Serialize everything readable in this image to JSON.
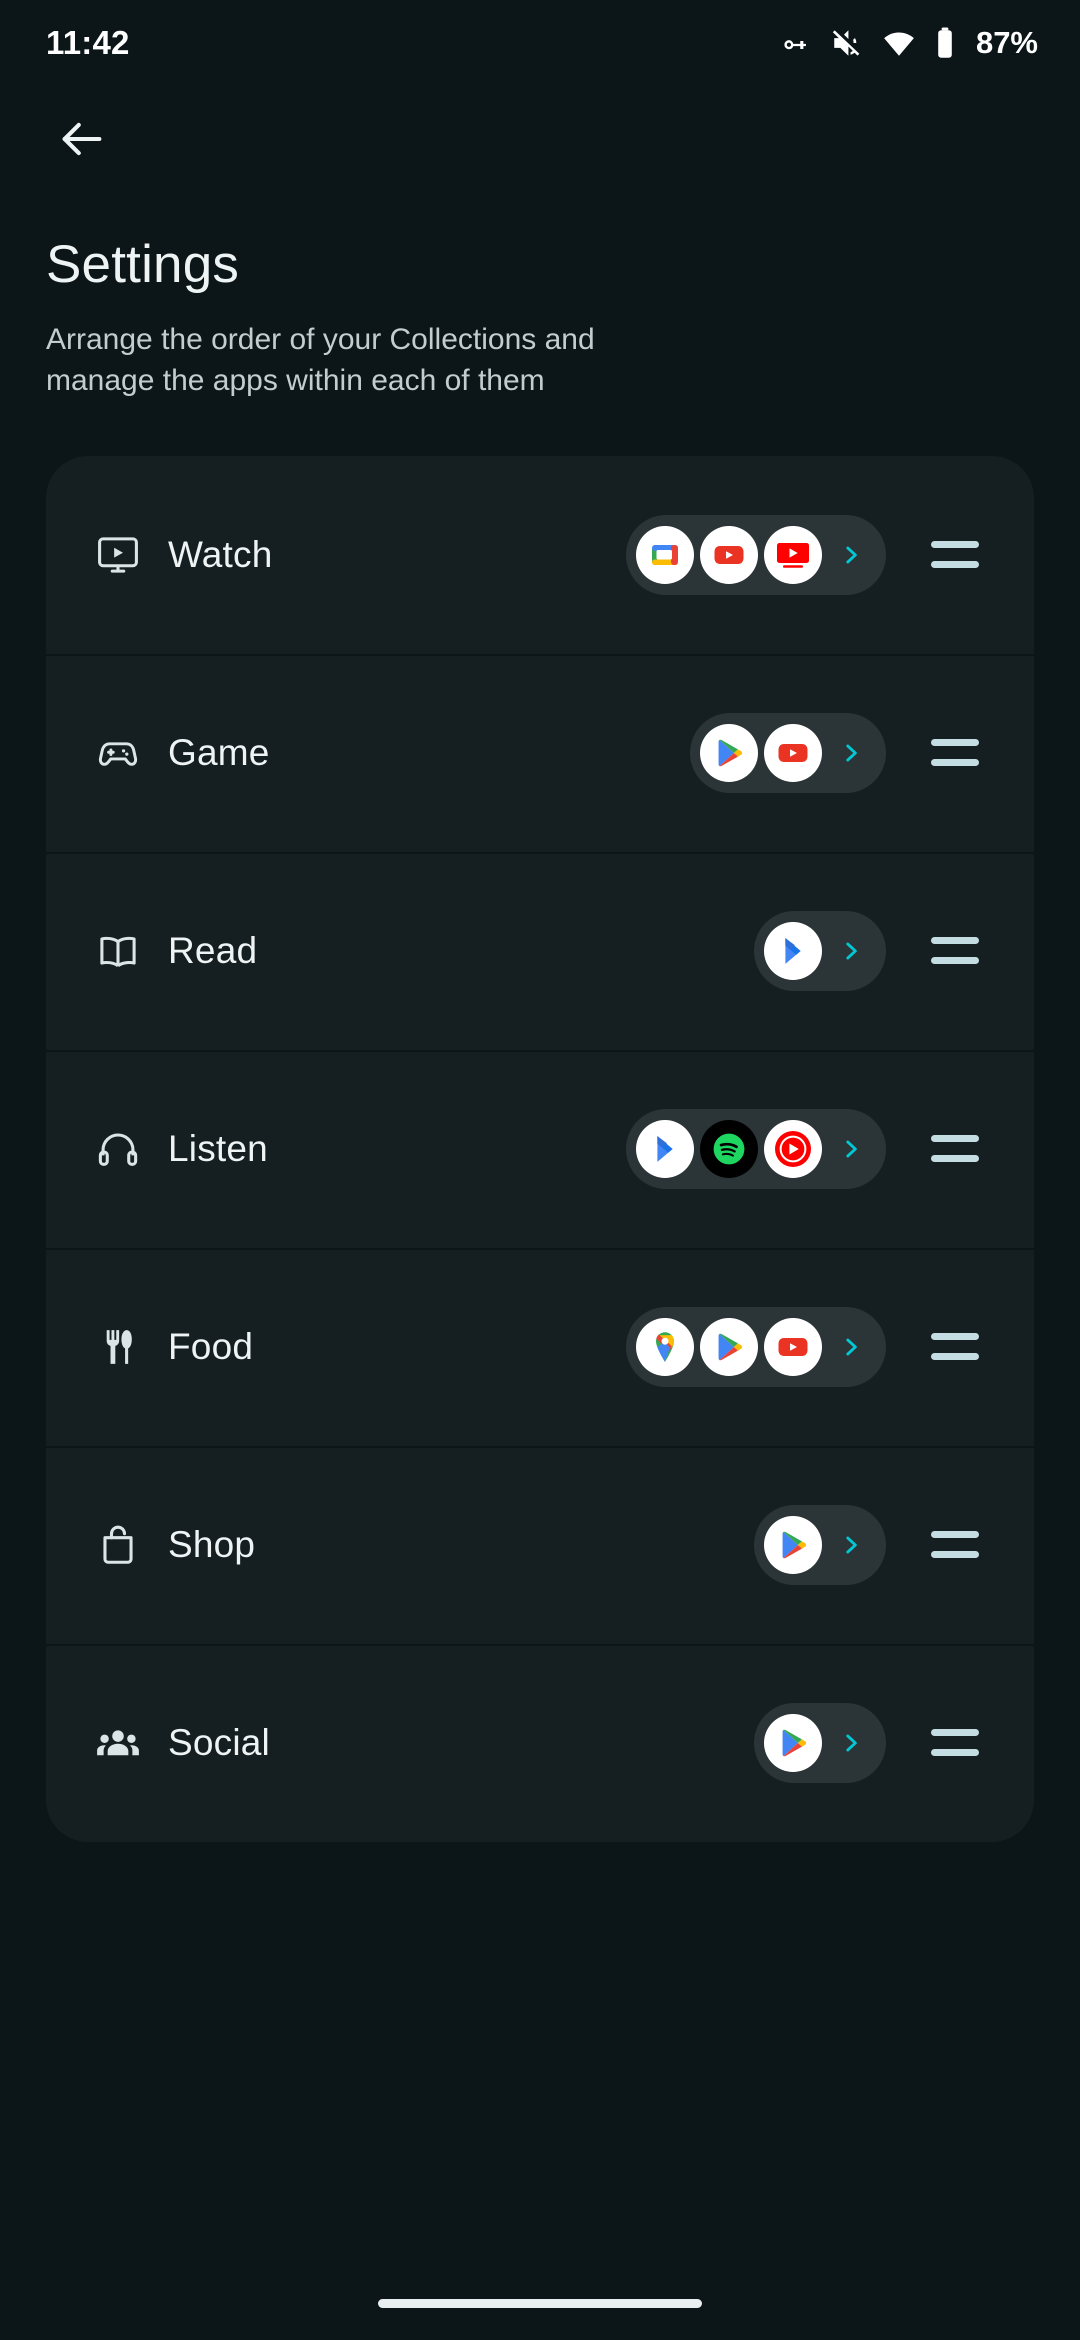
{
  "status_bar": {
    "time": "11:42",
    "battery_percent": "87%",
    "icons": [
      "vpn-key-icon",
      "volume-muted-icon",
      "wifi-icon",
      "battery-icon"
    ]
  },
  "nav": {
    "back_label": "back-arrow-icon"
  },
  "header": {
    "title": "Settings",
    "subtitle": "Arrange the order of your Collections and manage the apps within each of them"
  },
  "theme": {
    "background": "#0c1517",
    "card": "#151e20",
    "chip": "#2b3537",
    "accent_teal": "#00c9d4",
    "handle": "#c4dde2",
    "text_primary": "#eef3f4",
    "text_secondary": "#c3cdcf"
  },
  "collections": [
    {
      "label": "Watch",
      "icon": "tv-play-icon",
      "apps": [
        "google-tv-icon",
        "youtube-icon",
        "youtube-tv-icon"
      ],
      "expand_label": "chevron-right-icon",
      "handle_label": "drag-handle-icon"
    },
    {
      "label": "Game",
      "icon": "gamepad-icon",
      "apps": [
        "play-store-icon",
        "youtube-icon"
      ],
      "expand_label": "chevron-right-icon",
      "handle_label": "drag-handle-icon"
    },
    {
      "label": "Read",
      "icon": "book-icon",
      "apps": [
        "play-books-icon"
      ],
      "expand_label": "chevron-right-icon",
      "handle_label": "drag-handle-icon"
    },
    {
      "label": "Listen",
      "icon": "headphones-icon",
      "apps": [
        "play-books-icon",
        "spotify-icon",
        "youtube-music-icon"
      ],
      "expand_label": "chevron-right-icon",
      "handle_label": "drag-handle-icon"
    },
    {
      "label": "Food",
      "icon": "fork-knife-icon",
      "apps": [
        "google-maps-icon",
        "play-store-icon",
        "youtube-icon"
      ],
      "expand_label": "chevron-right-icon",
      "handle_label": "drag-handle-icon"
    },
    {
      "label": "Shop",
      "icon": "shopping-bag-icon",
      "apps": [
        "play-store-icon"
      ],
      "expand_label": "chevron-right-icon",
      "handle_label": "drag-handle-icon"
    },
    {
      "label": "Social",
      "icon": "people-group-icon",
      "apps": [
        "play-store-icon"
      ],
      "expand_label": "chevron-right-icon",
      "handle_label": "drag-handle-icon"
    }
  ]
}
